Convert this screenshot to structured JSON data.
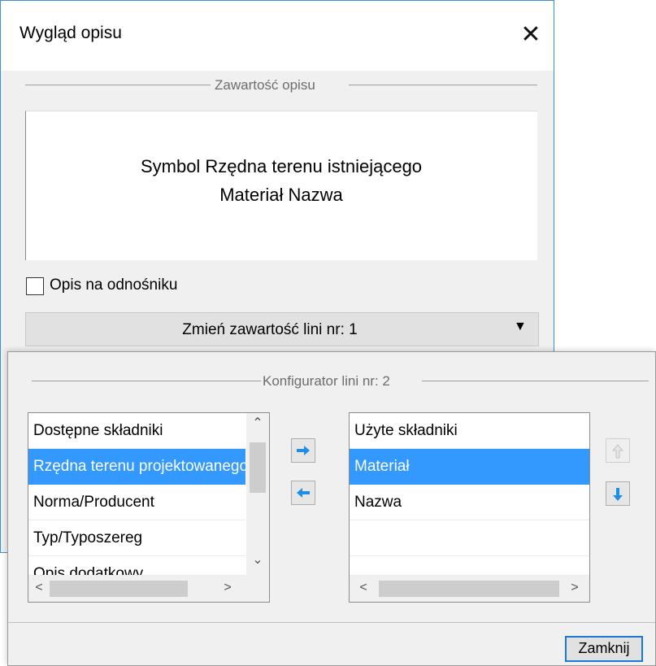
{
  "dialog_main": {
    "title": "Wygląd opisu",
    "close_glyph": "✕",
    "group_title": "Zawartość opisu",
    "content_lines": [
      "Symbol Rzędna terenu istniejącego",
      "Materiał Nazwa"
    ],
    "checkbox_label": "Opis na odnośniku",
    "checkbox_checked": false,
    "dropdown_value": "Zmień zawartość lini nr: 1",
    "dropdown_arrow": "▼"
  },
  "dialog_config": {
    "group_title": "Konfigurator lini nr: 2",
    "available": {
      "header": "Dostępne składniki",
      "items": [
        "Rzędna terenu projektowanego",
        "Norma/Producent",
        "Typ/Typoszereg",
        "Opis dodatkowy"
      ],
      "selected_index": 0
    },
    "used": {
      "header": "Użyte składniki",
      "items": [
        "Materiał",
        "Nazwa"
      ],
      "selected_index": 0
    },
    "icons": {
      "add": "arrow-right-icon",
      "remove": "arrow-left-icon",
      "move_up": "arrow-up-icon",
      "move_down": "arrow-down-icon"
    },
    "scroll_glyphs": {
      "up": "⌃",
      "down": "⌄",
      "left": "<",
      "right": ">"
    },
    "close_button": "Zamknij"
  },
  "colors": {
    "selection": "#3399ff",
    "accent_arrow": "#1f8ee6",
    "window_border": "#3c8fd8"
  }
}
